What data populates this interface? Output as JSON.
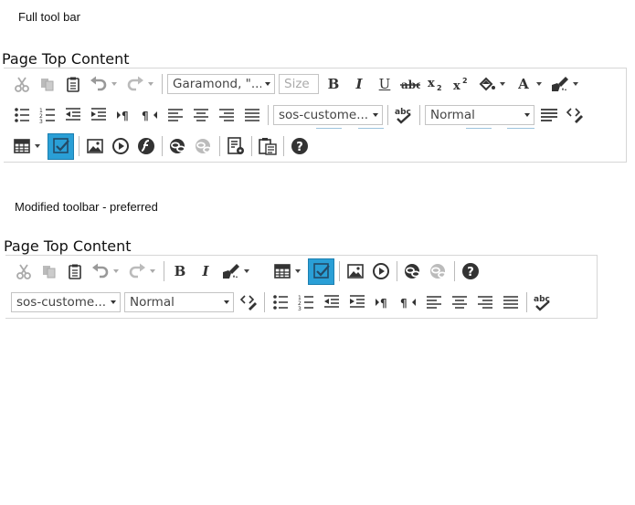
{
  "full": {
    "caption": "Full tool bar",
    "section_label": "Page Top Content",
    "font_combo": "Garamond, \"...",
    "size_combo_placeholder": "Size",
    "style_combo": "sos-custome...",
    "format_combo": "Normal"
  },
  "modified": {
    "caption": "Modified toolbar - preferred",
    "section_label": "Page Top Content",
    "style_combo": "sos-custome...",
    "format_combo": "Normal"
  },
  "colors": {
    "active_button": "#2a9fd6",
    "icon": "#333333",
    "icon_disabled": "#aaaaaa"
  }
}
